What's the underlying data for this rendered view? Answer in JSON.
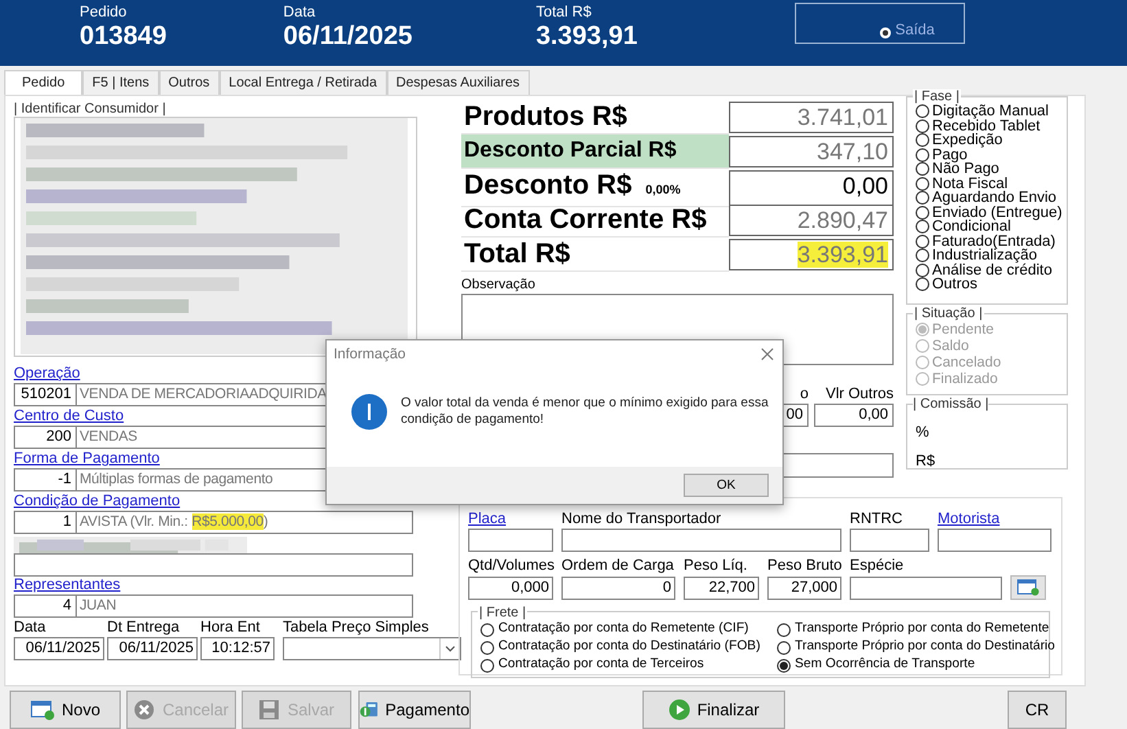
{
  "header": {
    "fields": [
      {
        "label": "Pedido",
        "value": "013849"
      },
      {
        "label": "Data",
        "value": "06/11/2025"
      },
      {
        "label": "Total R$",
        "value": "3.393,91"
      }
    ],
    "direction": {
      "label": "Saída",
      "selected": true
    }
  },
  "tabs": [
    {
      "label": "Pedido",
      "selected": true
    },
    {
      "label": "F5 | Itens",
      "selected": false
    },
    {
      "label": "Outros",
      "selected": false
    },
    {
      "label": "Local Entrega  / Retirada",
      "selected": false
    },
    {
      "label": "Despesas Auxiliares",
      "selected": false
    }
  ],
  "consumer": {
    "title": "| Identificar Consumidor |",
    "kind": "picture"
  },
  "left_fields": [
    {
      "kind": "field",
      "label": "Operação",
      "code": "510201",
      "value": "VENDA DE MERCADORIAADQUIRIDA"
    },
    {
      "kind": "field",
      "label": "Centro de Custo",
      "code": "200",
      "value": "VENDAS"
    },
    {
      "kind": "field",
      "label": "Forma de Pagamento",
      "code": "-1",
      "value": "Múltiplas formas de pagamento"
    },
    {
      "kind": "field",
      "label": "Condição de Pagamento",
      "code": "1",
      "value": "AVISTA (Vlr. Min.:",
      "highlight": "R$5.000,00",
      "suffix": ")"
    },
    {
      "kind": "blurred"
    },
    {
      "kind": "field",
      "label": "Representantes",
      "code": "4",
      "value": "JUAN"
    }
  ],
  "dates": [
    {
      "label": "Data",
      "value": "06/11/2025"
    },
    {
      "label": "Dt Entrega",
      "value": "06/11/2025"
    },
    {
      "label": "Hora Ent",
      "value": "10:12:57"
    }
  ],
  "price_table": {
    "label": "Tabela Preço Simples"
  },
  "totals": [
    {
      "kind": "plain",
      "label": "Produtos R$",
      "value": "3.741,01"
    },
    {
      "kind": "shaded",
      "label": "Desconto Parcial R$",
      "value": "347,10"
    },
    {
      "kind": "editable",
      "label": "Desconto R$",
      "note": "0,00%",
      "value": "0,00"
    },
    {
      "kind": "plain",
      "label": "Conta Corrente R$",
      "value": "2.890,47"
    },
    {
      "kind": "highlight",
      "label": "Total R$",
      "value": "3.393,91"
    }
  ],
  "observation": {
    "label": "Observação"
  },
  "extras": [
    {
      "label": "o",
      "value": "00"
    },
    {
      "label": "Vlr Outros",
      "value": "0,00"
    }
  ],
  "fase": {
    "title": "| Fase |",
    "options": [
      {
        "label": "Digitação Manual",
        "selected": false
      },
      {
        "label": "Recebido Tablet",
        "selected": false
      },
      {
        "label": "Expedição",
        "selected": false
      },
      {
        "label": "Pago",
        "selected": false
      },
      {
        "label": "Não Pago",
        "selected": false
      },
      {
        "label": "Nota Fiscal",
        "selected": false
      },
      {
        "label": "Aguardando Envio",
        "selected": false
      },
      {
        "label": "Enviado (Entregue)",
        "selected": false
      },
      {
        "label": "Condicional",
        "selected": false
      },
      {
        "label": "Faturado(Entrada)",
        "selected": false
      },
      {
        "label": "Industrialização",
        "selected": false
      },
      {
        "label": "Análise de crédito",
        "selected": false
      },
      {
        "label": "Outros",
        "selected": false
      }
    ]
  },
  "situacao": {
    "title": "| Situação |",
    "disabled": true,
    "options": [
      {
        "label": "Pendente",
        "selected": true
      },
      {
        "label": "Saldo",
        "selected": false
      },
      {
        "label": "Cancelado",
        "selected": false
      },
      {
        "label": "Finalizado",
        "selected": false
      }
    ]
  },
  "comissao": {
    "title": "| Comissão |",
    "rows": [
      "%",
      "R$"
    ]
  },
  "transport": {
    "row1": [
      {
        "label": "Placa",
        "link": true
      },
      {
        "label": "Nome do Transportador",
        "link": false
      },
      {
        "label": "RNTRC",
        "link": false
      },
      {
        "label": "Motorista",
        "link": true
      }
    ],
    "row2": [
      {
        "label": "Qtd/Volumes",
        "value": "0,000"
      },
      {
        "label": "Ordem de Carga",
        "value": "0"
      },
      {
        "label": "Peso Líq.",
        "value": "22,700"
      },
      {
        "label": "Peso Bruto",
        "value": "27,000"
      },
      {
        "label": "Espécie"
      }
    ],
    "frete": {
      "title": "| Frete |",
      "options": [
        {
          "label": "Contratação por conta do Remetente (CIF)",
          "selected": false
        },
        {
          "label": "Contratação por conta do Destinatário (FOB)",
          "selected": false
        },
        {
          "label": "Contratação por conta de Terceiros",
          "selected": false
        },
        {
          "label": "Transporte Próprio por conta do Remetente",
          "selected": false
        },
        {
          "label": "Transporte Próprio por conta do Destinatário",
          "selected": false
        },
        {
          "label": "Sem Ocorrência de Transporte",
          "selected": true
        }
      ]
    }
  },
  "buttons": [
    {
      "kind": "new",
      "label": "Novo",
      "disabled": false
    },
    {
      "kind": "cancel",
      "label": "Cancelar",
      "disabled": true
    },
    {
      "kind": "save",
      "label": "Salvar",
      "disabled": true
    },
    {
      "kind": "payment",
      "label": "Pagamento",
      "disabled": false
    },
    {
      "kind": "finish",
      "label": "Finalizar",
      "disabled": false
    },
    {
      "kind": "plain",
      "label": "CR",
      "disabled": false
    }
  ],
  "dialog": {
    "title": "Informação",
    "message": "O valor total da venda é menor que o mínimo exigido para essa condição de pagamento!",
    "button": "OK"
  }
}
